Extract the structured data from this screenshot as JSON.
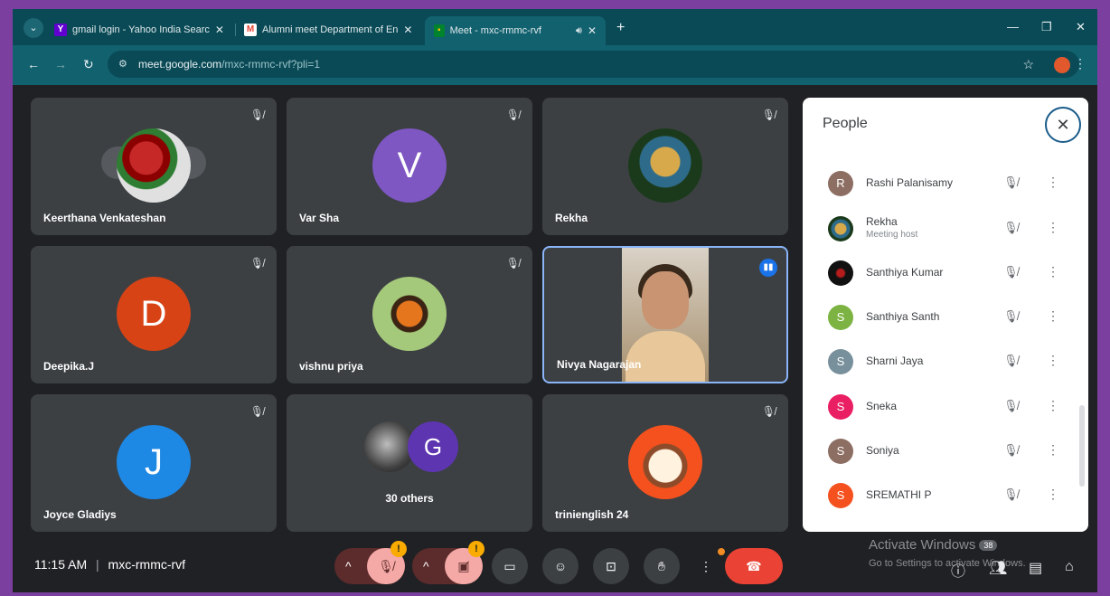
{
  "browser": {
    "tabs": [
      {
        "title": "gmail login - Yahoo India Searc",
        "close": "✕"
      },
      {
        "title": "Alumni meet Department of En",
        "close": "✕"
      },
      {
        "title": "Meet - mxc-rmmc-rvf",
        "close": "✕"
      }
    ],
    "new_tab": "+",
    "url_host": "meet.google.com",
    "url_path": "/mxc-rmmc-rvf?pli=1"
  },
  "tiles": [
    {
      "name": "Keerthana Venkateshan"
    },
    {
      "name": "Var Sha",
      "initial": "V"
    },
    {
      "name": "Rekha"
    },
    {
      "name": "Deepika.J",
      "initial": "D"
    },
    {
      "name": "vishnu priya"
    },
    {
      "name": "Nivya Nagarajan"
    },
    {
      "name": "Joyce Gladiys",
      "initial": "J"
    },
    {
      "initial": "G",
      "others_label": "30 others"
    },
    {
      "name": "trinienglish 24"
    }
  ],
  "people": {
    "title": "People",
    "close": "✕",
    "list": [
      {
        "name": "Rashi Palanisamy",
        "initial": "R",
        "color": "#8d6e63"
      },
      {
        "name": "Rekha",
        "subtitle": "Meeting host",
        "color": "#6b8e23"
      },
      {
        "name": "Santhiya Kumar",
        "color": "#1a1a1a"
      },
      {
        "name": "Santhiya Santh",
        "initial": "S",
        "color": "#7cb342"
      },
      {
        "name": "Sharni Jaya",
        "initial": "S",
        "color": "#78909c"
      },
      {
        "name": "Sneka",
        "initial": "S",
        "color": "#e91e63"
      },
      {
        "name": "Soniya",
        "initial": "S",
        "color": "#8d6e63"
      },
      {
        "name": "SREMATHI P",
        "initial": "S",
        "color": "#f4511e"
      }
    ]
  },
  "bottom": {
    "time": "11:15 AM",
    "separator": "|",
    "meeting_code": "mxc-rmmc-rvf",
    "warn": "!"
  },
  "watermark": {
    "line1": "Activate Windows",
    "badge": "38",
    "line2": "Go to Settings to activate Windows."
  },
  "colors": {
    "tab_strip": "#0a4a56",
    "meet_bg": "#202124",
    "tile_bg": "#3c4043",
    "accent_blue": "#1a73e8",
    "leave_red": "#ea4335"
  }
}
